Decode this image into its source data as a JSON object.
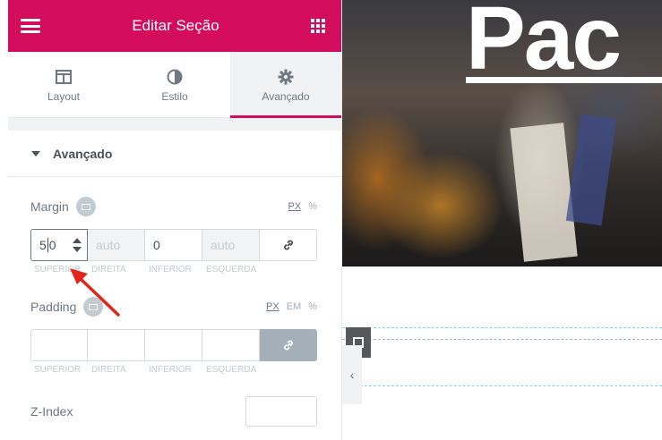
{
  "header": {
    "title": "Editar Seção"
  },
  "tabs": [
    {
      "label": "Layout",
      "icon": "layout-icon"
    },
    {
      "label": "Estilo",
      "icon": "contrast-icon"
    },
    {
      "label": "Avançado",
      "icon": "gear-icon",
      "active": true
    }
  ],
  "section": {
    "title": "Avançado"
  },
  "margin": {
    "label": "Margin",
    "units": [
      "PX",
      "%"
    ],
    "selected_unit": "PX",
    "values": {
      "top": "50",
      "right": "auto",
      "bottom": "0",
      "left": "auto"
    },
    "sublabels": [
      "Superior",
      "Direita",
      "Inferior",
      "Esquerda"
    ]
  },
  "padding": {
    "label": "Padding",
    "units": [
      "PX",
      "EM",
      "%"
    ],
    "selected_unit": "PX",
    "sublabels": [
      "Superior",
      "Direita",
      "Inferior",
      "Esquerda"
    ]
  },
  "zindex": {
    "label": "Z-Index"
  },
  "preview": {
    "hero_text": "Pac"
  },
  "colors": {
    "accent": "#d30c5c",
    "arrow": "#e1261c",
    "drop_zone": "#71d7f7"
  }
}
